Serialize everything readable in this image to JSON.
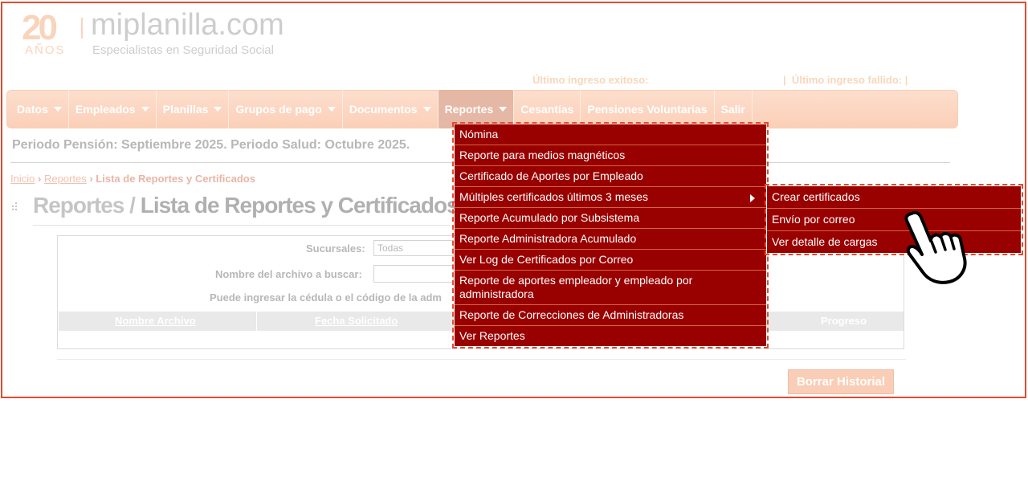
{
  "logo": {
    "anniversary": "20",
    "anos": "AÑOS",
    "site": "miplanilla.com",
    "tagline": "Especialistas en Seguridad Social"
  },
  "header": {
    "last_success": "Último ingreso exitoso:",
    "last_fail_sep": "|",
    "last_fail": "Último ingreso fallido:",
    "last_fail_end": "|"
  },
  "nav": [
    {
      "label": "Datos",
      "caret": true
    },
    {
      "label": "Empleados",
      "caret": true
    },
    {
      "label": "Planillas",
      "caret": true
    },
    {
      "label": "Grupos de pago",
      "caret": true
    },
    {
      "label": "Documentos",
      "caret": true
    },
    {
      "label": "Reportes",
      "caret": true
    },
    {
      "label": "Cesantías",
      "caret": false
    },
    {
      "label": "Pensiones Voluntarias",
      "caret": false
    },
    {
      "label": "Salir",
      "caret": false
    }
  ],
  "periodo": "Periodo Pensión: Septiembre 2025. Periodo Salud: Octubre 2025.",
  "breadcrumb": {
    "home": "Inicio",
    "sep1": "›",
    "reportes": "Reportes",
    "sep2": "›",
    "current": "Lista de Reportes y Certificados"
  },
  "title": {
    "part1": "Reportes /",
    "part2": "Lista de Reportes y Certificados"
  },
  "form": {
    "sucursales_label": "Sucursales:",
    "sucursales_value": "Todas",
    "archivo_label": "Nombre del archivo a buscar:",
    "hint": "Puede ingresar la cédula o el código de la adm"
  },
  "table": {
    "col1": "Nombre Archivo",
    "col2": "Fecha Solicitado",
    "col3": "Progreso"
  },
  "borrar_button": "Borrar Historial",
  "reportes_menu": [
    "Nómina",
    "Reporte para medios magnéticos",
    "Certificado de Aportes por Empleado",
    "Múltiples certificados últimos 3 meses",
    "Reporte Acumulado por Subsistema",
    "Reporte Administradora Acumulado",
    "Ver Log de Certificados por Correo",
    "Reporte de aportes empleador y empleado por administradora",
    "Reporte de Correcciones de Administradoras",
    "Ver Reportes"
  ],
  "submenu": [
    "Crear certificados",
    "Envío por correo",
    "Ver detalle de cargas"
  ],
  "colors": {
    "accent": "#f78f57",
    "menu_bg": "#990000",
    "highlight_border": "#e34b2f"
  }
}
